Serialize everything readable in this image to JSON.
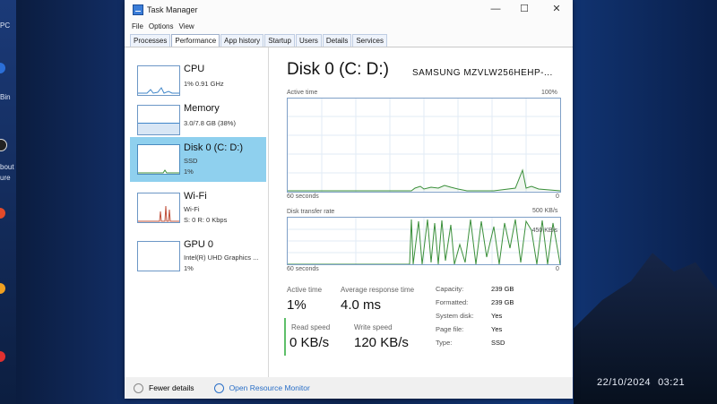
{
  "window": {
    "title": "Task Manager",
    "minimize": "—",
    "maximize": "☐",
    "close": "✕"
  },
  "menu": [
    "File",
    "Options",
    "View"
  ],
  "tabs": [
    "Processes",
    "Performance",
    "App history",
    "Startup",
    "Users",
    "Details",
    "Services"
  ],
  "active_tab": "Performance",
  "sidebar": [
    {
      "title": "CPU",
      "sub1": "1% 0.91 GHz",
      "sub2": ""
    },
    {
      "title": "Memory",
      "sub1": "3.0/7.8 GB (38%)",
      "sub2": ""
    },
    {
      "title": "Disk 0 (C: D:)",
      "sub1": "SSD",
      "sub2": "1%"
    },
    {
      "title": "Wi-Fi",
      "sub1": "Wi-Fi",
      "sub2": "S: 0 R: 0 Kbps"
    },
    {
      "title": "GPU 0",
      "sub1": "Intel(R) UHD Graphics ...",
      "sub2": "1%"
    }
  ],
  "selected_item": "Disk 0 (C: D:)",
  "detail": {
    "title": "Disk 0 (C: D:)",
    "model": "SAMSUNG MZVLW256HEHP-...",
    "graph1": {
      "label": "Active time",
      "max": "100%",
      "xlabel": "60 seconds",
      "xmin": "0"
    },
    "graph2": {
      "label": "Disk transfer rate",
      "max": "500 KB/s",
      "inner": "450 KB/s",
      "xlabel": "60 seconds",
      "xmin": "0"
    },
    "stats": {
      "active_time_label": "Active time",
      "active_time": "1%",
      "response_label": "Average response time",
      "response": "4.0 ms",
      "read_label": "Read speed",
      "read": "0 KB/s",
      "write_label": "Write speed",
      "write": "120 KB/s"
    },
    "props": [
      {
        "k": "Capacity:",
        "v": "239 GB"
      },
      {
        "k": "Formatted:",
        "v": "239 GB"
      },
      {
        "k": "System disk:",
        "v": "Yes"
      },
      {
        "k": "Page file:",
        "v": "Yes"
      },
      {
        "k": "Type:",
        "v": "SSD"
      }
    ]
  },
  "footer": {
    "fewer": "Fewer details",
    "monitor": "Open Resource Monitor"
  },
  "desktop": {
    "labels": [
      "PC",
      "Bin",
      "bout",
      "ure"
    ],
    "date": "22/10/2024",
    "time": "03:21"
  },
  "colors": {
    "selected": "#8fd0ee",
    "graph_line": "#3a8f3a",
    "border": "#7fa0c7"
  }
}
